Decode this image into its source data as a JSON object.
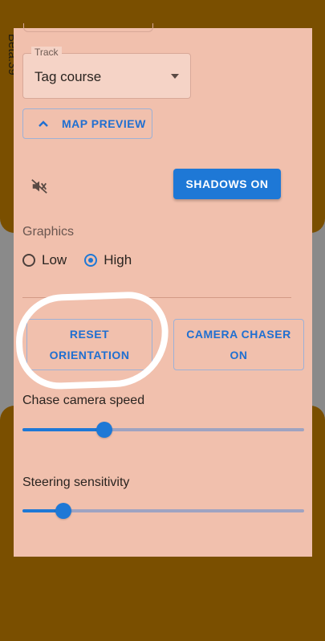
{
  "beta_label": "Beta:39",
  "track": {
    "label": "Track",
    "value": "Tag course"
  },
  "map_preview_label": "MAP PREVIEW",
  "shadows_label": "SHADOWS ON",
  "graphics": {
    "title": "Graphics",
    "options": [
      {
        "label": "Low",
        "selected": false
      },
      {
        "label": "High",
        "selected": true
      }
    ]
  },
  "buttons": {
    "reset_line1": "RESET",
    "reset_line2": "ORIENTATION",
    "chaser_line1": "CAMERA CHASER",
    "chaser_line2": "ON"
  },
  "sliders": {
    "chase_speed": {
      "label": "Chase camera speed",
      "value": 0.29
    },
    "steering": {
      "label": "Steering sensitivity",
      "value": 0.145
    }
  },
  "icons": {
    "mute": "volume-off-icon",
    "chevron": "chevron-up-icon"
  },
  "colors": {
    "accent": "#1e78d6",
    "panel": "#f1c0ad",
    "background": "#7a4f00"
  }
}
